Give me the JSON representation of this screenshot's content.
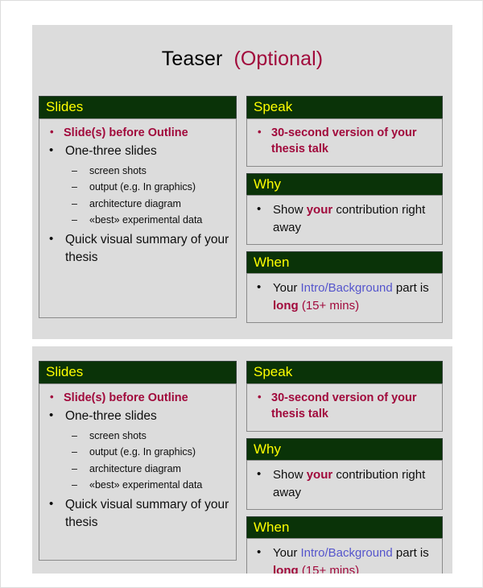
{
  "slide": {
    "title_main": "Teaser",
    "title_optional": "(Optional)",
    "colors": {
      "header_bg": "#0a3308",
      "header_text": "#ffff00",
      "accent_red": "#a10a3c",
      "link_blue": "#5555cc",
      "panel_bg": "#dcdcdc"
    },
    "panels": {
      "slides": {
        "header": "Slides",
        "bullets": [
          {
            "text": "Slide(s) before Outline",
            "style": "accent"
          },
          {
            "text": "One-three slides",
            "style": "normal"
          },
          {
            "text": "Quick visual summary of your thesis",
            "style": "normal"
          }
        ],
        "sub_bullets": [
          "screen shots",
          "output (e.g. In graphics)",
          "architecture diagram",
          "«best» experimental data"
        ]
      },
      "speak": {
        "header": "Speak",
        "bullet": "30-second version of your thesis talk"
      },
      "why": {
        "header": "Why",
        "bullet_parts": {
          "pre": "Show ",
          "emphasis": "your",
          "post": " contribution right away"
        }
      },
      "when": {
        "header": "When",
        "bullet_parts": {
          "pre": "Your ",
          "link": "Intro/Background",
          "mid": " part is ",
          "emphasis": "long",
          "post": " (15+ mins)"
        }
      }
    }
  }
}
